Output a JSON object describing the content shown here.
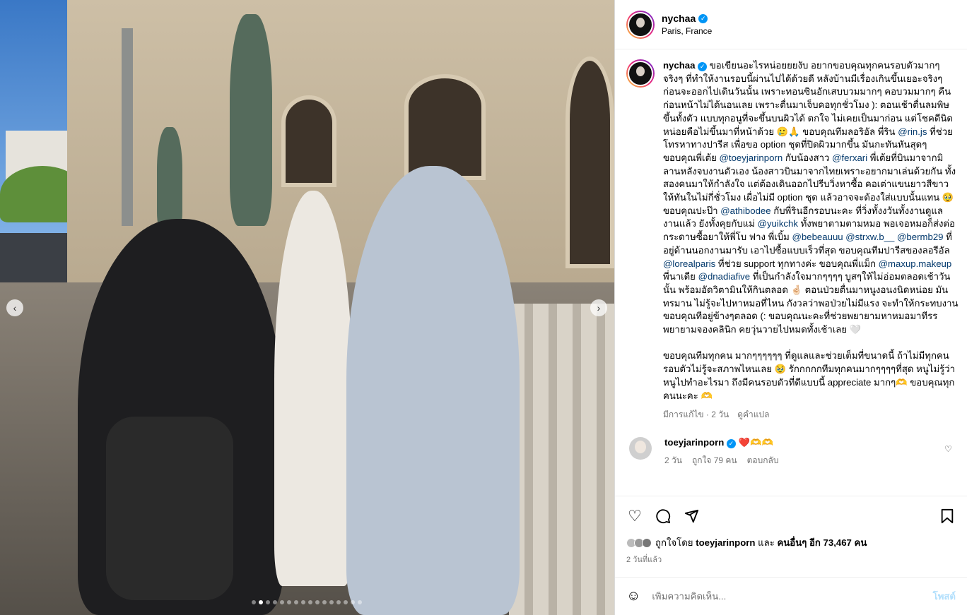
{
  "post": {
    "username": "nychaa",
    "location": "Paris, France",
    "caption_parts": [
      {
        "t": "text",
        "v": "ขอเขียนอะไรหน่อยยยงับ อยากขอบคุณทุกคนรอบตัวมากๆ จริงๆ ที่ทำให้งานรอบนี้ผ่านไปได้ด้วยดี หลังบ้านมีเรื่องเกินขึ้นเยอะจริงๆ ก่อนจะออกไปเดินวันนั้น เพราะทอนซินอักเสบบวมมากๆ คอบวมมากๆ คืนก่อนหน้าไม่ได้นอนเลย เพราะตื่นมาเจ็บคอทุกชั่วโมง ): ตอนเช้าตื่นลมพิษขึ้นทั้งตัว แบบทุกอนูที่จะขึ้นบนผิวได้ ตกใจ ไม่เคยเป็นมาก่อน แต่โชคดีนิดหน่อยคือไม่ขึ้นมาที่หน้าด้วย 🥲🙏 ขอบคุณทีมลอริอัล พี่ริน "
      },
      {
        "t": "mention",
        "v": "@rin.js"
      },
      {
        "t": "text",
        "v": " ที่ช่วยโทรหาทางปารีส เพื่อขอ option ชุดที่ปิดผิวมากขึ้น มันกะทันหันสุดๆ ขอบคุณพี่เต้ย "
      },
      {
        "t": "mention",
        "v": "@toeyjarinporn"
      },
      {
        "t": "text",
        "v": " กับน้องสาว "
      },
      {
        "t": "mention",
        "v": "@ferxari"
      },
      {
        "t": "text",
        "v": " พี่เต้ยที่บินมาจากมิลานหลังจบงานตัวเอง น้องสาวบินมาจากไทยเพราะอยากมาเล่นด้วยกัน ทั้งสองคนมาให้กำลังใจ แต่ต้องเดินออกไปรีบวิ่งหาซื้อ คอเต่าแขนยาวสีขาวให้ทันในไม่กี่ชั่วโมง เผื่อไม่มี option ชุด แล้วอาจจะต้องใส่แบบนั้นแทน 🥹 ขอบคุณปะป๊า "
      },
      {
        "t": "mention",
        "v": "@athibodee"
      },
      {
        "t": "text",
        "v": " กับพี่รินอีกรอบนะคะ ที่วิ่งทั้งงวันทั้งงานดูแลงานแล้ว ยังทั้งคุยกับแม่ "
      },
      {
        "t": "mention",
        "v": "@yuikchk"
      },
      {
        "t": "text",
        "v": " ทั้งพยาตามตามหมอ พอเจอหมอก็ส่งต่อกระดาษซื้อยาให้พี่โบ ฟาง พี่เบิ้ม "
      },
      {
        "t": "mention",
        "v": "@bebeauuu"
      },
      {
        "t": "text",
        "v": " "
      },
      {
        "t": "mention",
        "v": "@strxw.b__"
      },
      {
        "t": "text",
        "v": " "
      },
      {
        "t": "mention",
        "v": "@bermb29"
      },
      {
        "t": "text",
        "v": " ที่อยู่ด้านนอกงานมารับ เอาไปซื้อแบบเร็วที่สุด ขอบคุณทีมปารีสของลอรีอัล "
      },
      {
        "t": "mention",
        "v": "@lorealparis"
      },
      {
        "t": "text",
        "v": " ที่ช่วย support ทุกทางค่ะ ขอบคุณพี่แม็ก "
      },
      {
        "t": "mention",
        "v": "@maxup.makeup"
      },
      {
        "t": "text",
        "v": " พี่นาเดีย "
      },
      {
        "t": "mention",
        "v": "@dnadiafive"
      },
      {
        "t": "text",
        "v": " ที่เป็นกำลังใจมากๆๆๆๆ บูสๆให้ไม่อ่อมตลอดเช้าวันนั้น พร้อมอัดวิตามินให้กินตลอด 🤞🏻 ตอนป่วยตื่นมาหนูงอนงนิดหน่อย มันทรมาน ไม่รู้จะไปหาหมอที่ไหน กังวลว่าพอป่วยไม่มีแรง จะทำให้กระทบงาน ขอบคุณทีอยู่ข้างๆตลอด (: ขอบคุณนะคะที่ช่วยพยายามหาหมอมาทีรร พยายามจองคลินิก คยวุ่นวายไปหมดทั้งเช้าเลย 🤍\n\nขอบคุณทีมทุกคน มากๆๆๆๆๆๆ ที่ดูแลและช่วยเต็มที่ขนาดนี้ ถ้าไม่มีทุกคนรอบตัวไม่รู้จะสภาพไหนเลย 🥹 รักกกกกทีมทุกคนมากๆๆๆๆที่สุด หนูไม่รู้ว่าหนูไปทำอะไรมา ถึงมีคนรอบตัวที่ดีแบบนี้ appreciate มากๆ🫶 ขอบคุณทุกคนนะคะ 🫶"
      }
    ],
    "edited": "มีการแก้ไข · 2 วัน",
    "translate": "ดูคำแปล",
    "comment": {
      "username": "toeyjarinporn",
      "text": "❤️",
      "extra": "🫶🫶",
      "time": "2 วัน",
      "likes": "ถูกใจ 79 คน",
      "reply": "ตอบกลับ"
    },
    "likes": {
      "prefix": "ถูกใจโดย",
      "user": "toeyjarinporn",
      "mid": "และ",
      "others": "คนอื่นๆ อีก 73,467 คน"
    },
    "ago": "2 วันที่แล้ว",
    "comment_placeholder": "เพิ่มความคิดเห็น...",
    "post_label": "โพสต์"
  },
  "icons": {
    "heart": "♡",
    "comment": "◯",
    "share": "➤",
    "save": "⌑",
    "emoji": "☺",
    "prev": "‹",
    "next": "›"
  },
  "carousel": {
    "count": 16,
    "active": 1
  }
}
